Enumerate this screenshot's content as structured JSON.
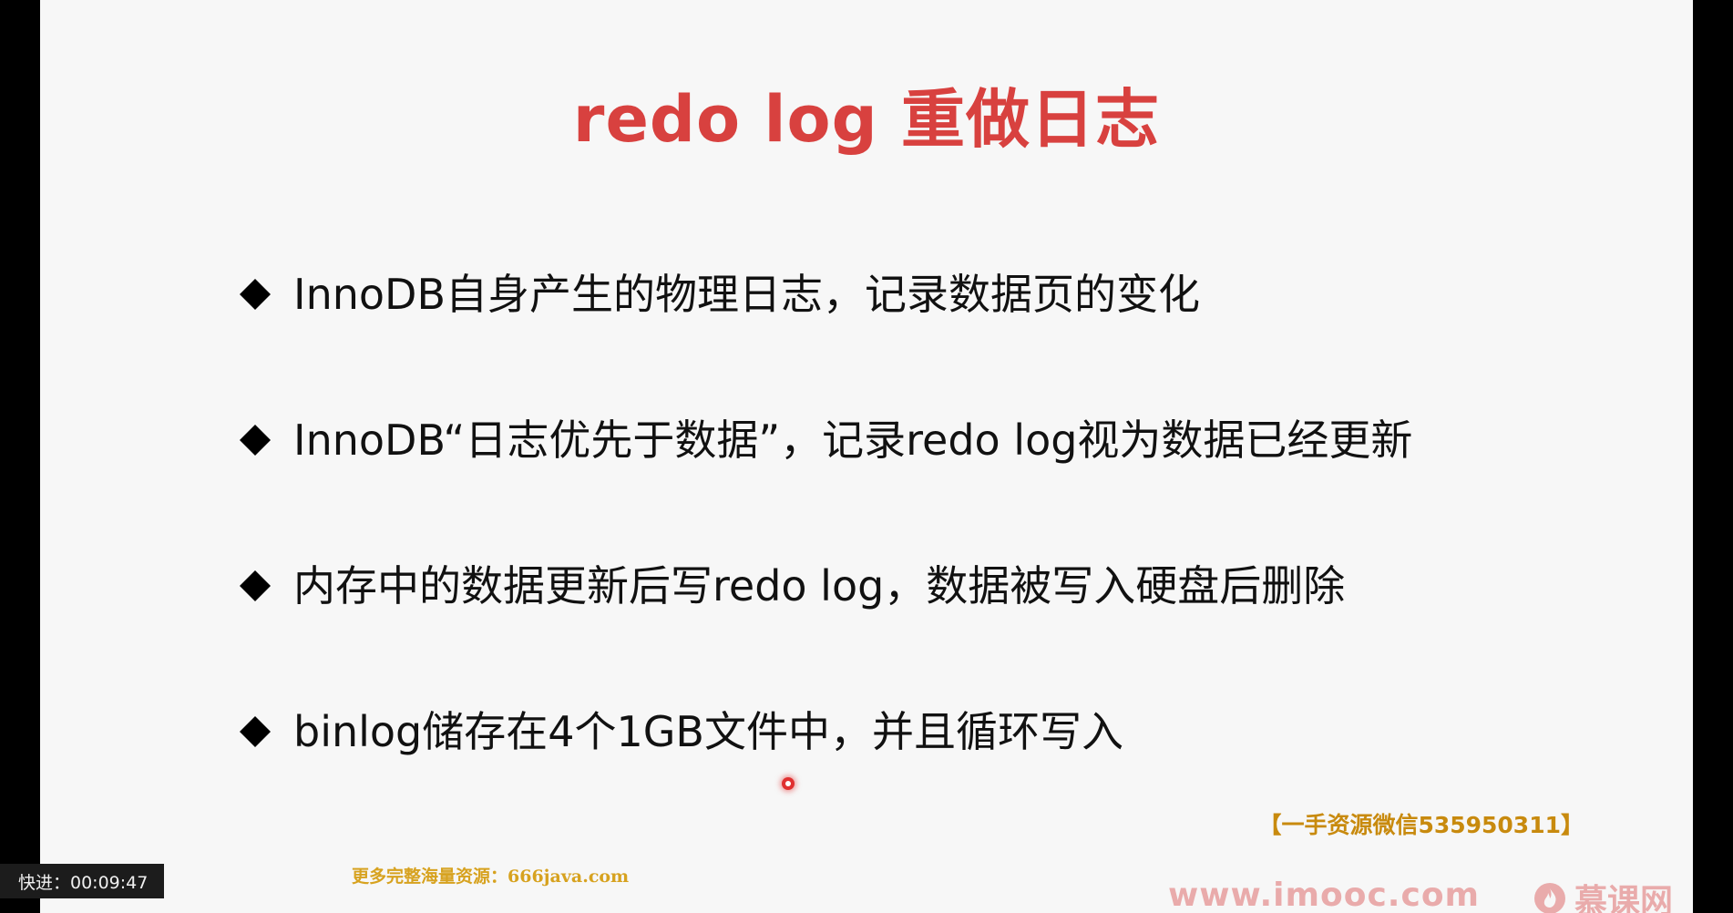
{
  "slide": {
    "title": "redo log 重做日志",
    "bullets": [
      "InnoDB自身产生的物理日志，记录数据页的变化",
      "InnoDB“日志优先于数据”，记录redo log视为数据已经更新",
      "内存中的数据更新后写redo log，数据被写入硬盘后删除",
      "binlog储存在4个1GB文件中，并且循环写入"
    ],
    "bullet_icon": "diamond-icon",
    "title_color": "#d8413f"
  },
  "watermarks": {
    "wechat": "【一手资源微信535950311】",
    "site": "更多完整海量资源：666java.com",
    "imooc_url": "www.imooc.com",
    "imooc_logo_text": "慕课网",
    "imooc_logo_icon": "flame-icon"
  },
  "player": {
    "playback_status": "快进：00:09:47"
  }
}
